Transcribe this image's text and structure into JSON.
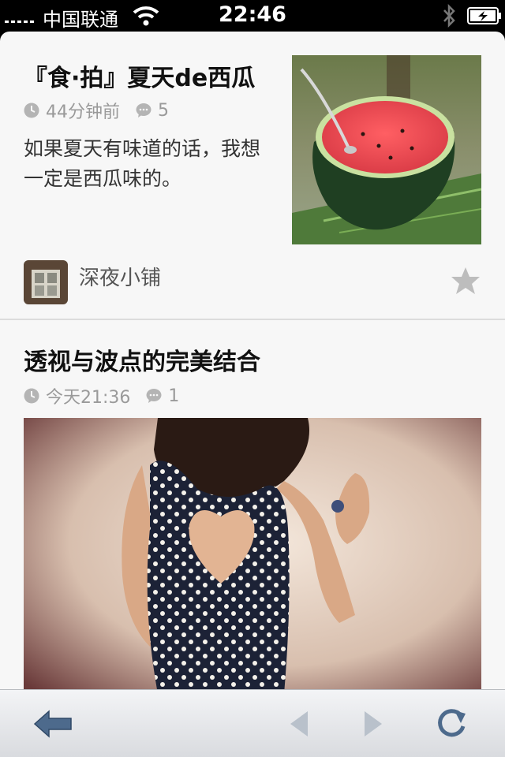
{
  "status_bar": {
    "carrier": "中国联通",
    "time": "22:46"
  },
  "articles": [
    {
      "title": "『食·拍』夏天de西瓜",
      "time": "44分钟前",
      "comments": "5",
      "description": "如果夏天有味道的话，我想一定是西瓜味的。",
      "author": "深夜小铺"
    },
    {
      "title": "透视与波点的完美结合",
      "time": "今天21:36",
      "comments": "1"
    }
  ],
  "icons": {
    "time": "clock-icon",
    "comments": "comment-bubble-icon",
    "favorite": "star-icon",
    "back": "back-arrow-icon",
    "prev": "triangle-left-icon",
    "next": "triangle-right-icon",
    "refresh": "refresh-icon"
  },
  "colors": {
    "background": "#f7f7f7",
    "meta_text": "#9a9a9a",
    "toolbar_icon": "#4d6a8c",
    "toolbar_icon_disabled": "#b9c1cb"
  }
}
